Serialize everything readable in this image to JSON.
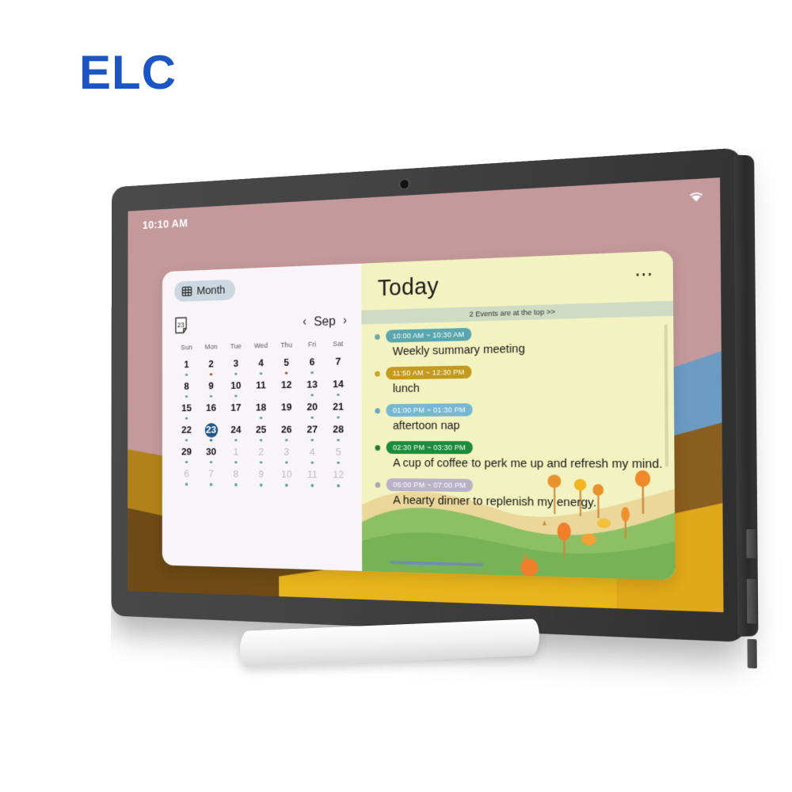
{
  "brand": {
    "logo_text": "ELC"
  },
  "device": {
    "camera_name": "front-camera",
    "side_buttons": [
      "power-button",
      "volume-button",
      "extra-button"
    ]
  },
  "statusbar": {
    "time": "10:10 AM",
    "wifi_icon": "wifi-icon"
  },
  "calendar": {
    "view_button": {
      "label": "Month",
      "icon": "grid-icon"
    },
    "date_icon": {
      "name": "calendar-date-icon",
      "label": "23"
    },
    "prev_icon": "chevron-left-icon",
    "next_icon": "chevron-right-icon",
    "month_label": "Sep",
    "day_headers": [
      "Sun",
      "Mon",
      "Tue",
      "Wed",
      "Thu",
      "Fri",
      "Sat"
    ],
    "selected_day": 23,
    "weeks": [
      [
        {
          "n": "1",
          "muted": false,
          "dot": "teal"
        },
        {
          "n": "2",
          "muted": false,
          "dot": "orange"
        },
        {
          "n": "3",
          "muted": false,
          "dot": "teal"
        },
        {
          "n": "4",
          "muted": false,
          "dot": "teal"
        },
        {
          "n": "5",
          "muted": false,
          "dot": "orange"
        },
        {
          "n": "6",
          "muted": false,
          "dot": "teal"
        },
        {
          "n": "7",
          "muted": false,
          "dot": "none"
        }
      ],
      [
        {
          "n": "8",
          "muted": false,
          "dot": "teal"
        },
        {
          "n": "9",
          "muted": false,
          "dot": "teal"
        },
        {
          "n": "10",
          "muted": false,
          "dot": "teal"
        },
        {
          "n": "11",
          "muted": false,
          "dot": "none"
        },
        {
          "n": "12",
          "muted": false,
          "dot": "none"
        },
        {
          "n": "13",
          "muted": false,
          "dot": "teal"
        },
        {
          "n": "14",
          "muted": false,
          "dot": "teal"
        }
      ],
      [
        {
          "n": "15",
          "muted": false,
          "dot": "teal"
        },
        {
          "n": "16",
          "muted": false,
          "dot": "none"
        },
        {
          "n": "17",
          "muted": false,
          "dot": "none"
        },
        {
          "n": "18",
          "muted": false,
          "dot": "teal"
        },
        {
          "n": "19",
          "muted": false,
          "dot": "none"
        },
        {
          "n": "20",
          "muted": false,
          "dot": "teal"
        },
        {
          "n": "21",
          "muted": false,
          "dot": "teal"
        }
      ],
      [
        {
          "n": "22",
          "muted": false,
          "dot": "teal"
        },
        {
          "n": "23",
          "muted": false,
          "dot": "blue",
          "selected": true
        },
        {
          "n": "24",
          "muted": false,
          "dot": "teal"
        },
        {
          "n": "25",
          "muted": false,
          "dot": "teal"
        },
        {
          "n": "26",
          "muted": false,
          "dot": "teal"
        },
        {
          "n": "27",
          "muted": false,
          "dot": "teal"
        },
        {
          "n": "28",
          "muted": false,
          "dot": "teal"
        }
      ],
      [
        {
          "n": "29",
          "muted": false,
          "dot": "teal"
        },
        {
          "n": "30",
          "muted": false,
          "dot": "teal"
        },
        {
          "n": "1",
          "muted": true,
          "dot": "teal"
        },
        {
          "n": "2",
          "muted": true,
          "dot": "teal"
        },
        {
          "n": "3",
          "muted": true,
          "dot": "teal"
        },
        {
          "n": "4",
          "muted": true,
          "dot": "teal"
        },
        {
          "n": "5",
          "muted": true,
          "dot": "teal"
        }
      ],
      [
        {
          "n": "6",
          "muted": true,
          "dot": "teal"
        },
        {
          "n": "7",
          "muted": true,
          "dot": "teal"
        },
        {
          "n": "8",
          "muted": true,
          "dot": "teal"
        },
        {
          "n": "9",
          "muted": true,
          "dot": "teal"
        },
        {
          "n": "10",
          "muted": true,
          "dot": "teal"
        },
        {
          "n": "11",
          "muted": true,
          "dot": "teal"
        },
        {
          "n": "12",
          "muted": true,
          "dot": "teal"
        }
      ]
    ]
  },
  "today": {
    "title": "Today",
    "more_icon": "more-options-icon",
    "banner": "2 Events are at the top >>",
    "events": [
      {
        "time": "10:00 AM ~ 10:30 AM",
        "title": "Weekly summary meeting",
        "color": "#5aa6ae",
        "dot": "#6fa9a4"
      },
      {
        "time": "11:50 AM ~ 12:30 PM",
        "title": "lunch",
        "color": "#c39a1e",
        "dot": "#cda227"
      },
      {
        "time": "01:00 PM ~ 01:30 PM",
        "title": "aftertoon nap",
        "color": "#76b8d2",
        "dot": "#6aa8bd"
      },
      {
        "time": "02:30 PM ~ 03:30 PM",
        "title": "A cup of coffee to perk me up and refresh my mind.",
        "color": "#1e8b3c",
        "dot": "#1f7f38"
      },
      {
        "time": "06:00 PM ~ 07:00 PM",
        "title": "A hearty dinner to replenish my energy.",
        "color": "#b7b2c6",
        "dot": "#a9a7ad"
      }
    ]
  },
  "colors": {
    "brand_blue": "#1b56c4",
    "wallpaper_rose": "#c4999b",
    "wallpaper_gold": "#e0a81a",
    "selected_day_bg": "#1d5484",
    "today_panel_bg": "#f3f3c2",
    "card_bg": "#f9f4f7"
  }
}
